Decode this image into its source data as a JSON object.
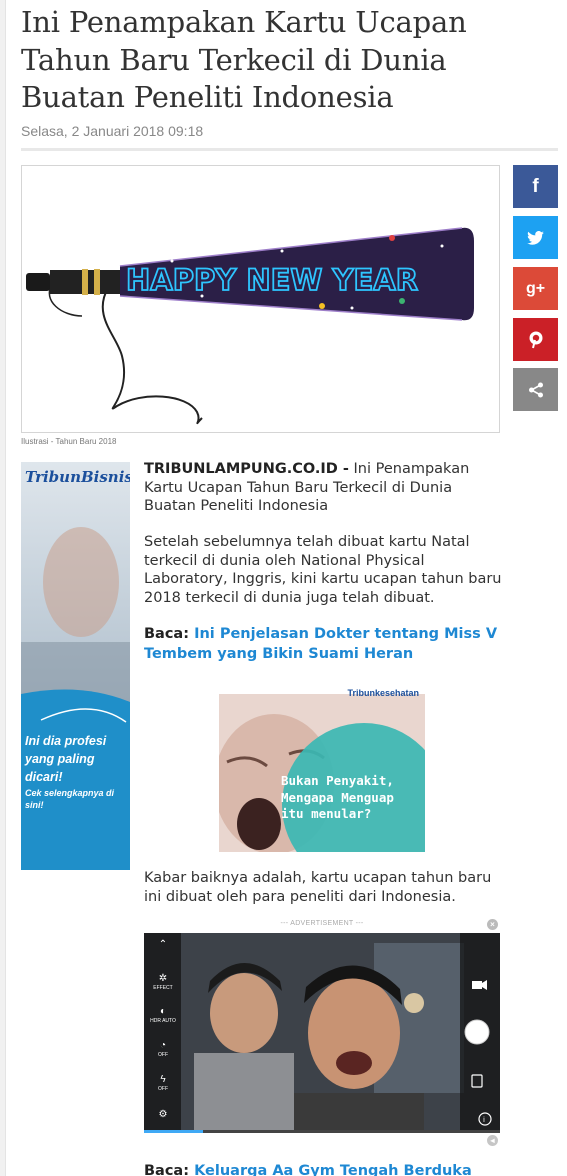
{
  "article": {
    "title": "Ini Penampakan Kartu Ucapan Tahun Baru Terkecil di Dunia Buatan Peneliti Indonesia",
    "date": "Selasa, 2 Januari 2018 09:18",
    "hero_caption": "Ilustrasi - Tahun Baru 2018",
    "hero_text": "HAPPY NEW YEAR",
    "source": "TRIBUNLAMPUNG.CO.ID -",
    "lead": "Ini Penampakan Kartu Ucapan Tahun Baru Terkecil di Dunia Buatan Peneliti Indonesia",
    "paragraph_1": "Setelah sebelumnya telah dibuat kartu Natal terkecil di dunia oleh National Physical Laboratory, Inggris, kini kartu ucapan tahun baru 2018 terkecil di dunia juga telah dibuat.",
    "baca_label": "Baca:",
    "baca_1": "Ini Penjelasan Dokter tentang Miss V Tembem yang Bikin Suami Heran",
    "paragraph_2": "Kabar baiknya adalah, kartu ucapan tahun baru ini dibuat oleh para peneliti dari Indonesia.",
    "baca_2": "Keluarga Aa Gym Tengah Berduka"
  },
  "share": {
    "facebook": "f",
    "twitter": "t",
    "googleplus": "g+",
    "pinterest": "P",
    "more": "share"
  },
  "side_ad": {
    "logo": "TribunBisnis",
    "tagline": "Ini dia profesi yang paling dicari!",
    "cta": "Cek selengkapnya di sini!"
  },
  "inline_ad": {
    "brand": "Tribunkesehatan",
    "message": "Bukan Penyakit, Mengapa Menguap itu menular?"
  },
  "video_ad": {
    "label": "--- ADVERTISEMENT ---",
    "controls": [
      "EFFECT",
      "HDR AUTO",
      "OFF",
      "OFF"
    ],
    "progress_fraction": 0.166
  },
  "colors": {
    "facebook": "#3b5998",
    "twitter": "#1da1f2",
    "googleplus": "#dc4a38",
    "pinterest": "#cb2027",
    "more": "#888888",
    "link": "#1e88d3"
  }
}
